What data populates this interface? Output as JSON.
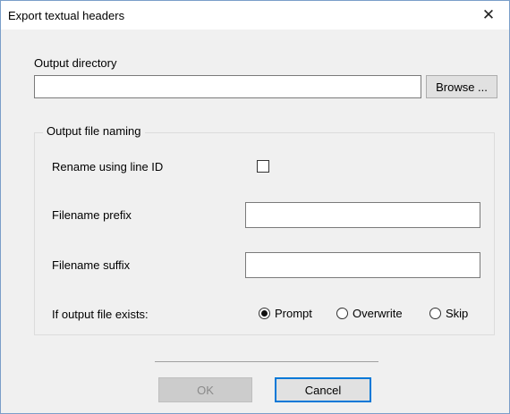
{
  "window": {
    "title": "Export textual headers",
    "close_glyph": "✕"
  },
  "output": {
    "directory_label": "Output directory",
    "directory_value": "",
    "browse_label": "Browse ..."
  },
  "naming": {
    "group_label": "Output file naming",
    "rename_label": "Rename using line ID",
    "rename_checked": false,
    "prefix_label": "Filename prefix",
    "prefix_value": "",
    "suffix_label": "Filename suffix",
    "suffix_value": "",
    "exists_label": "If output file exists:",
    "exists_options": [
      {
        "label": "Prompt",
        "selected": true
      },
      {
        "label": "Overwrite",
        "selected": false
      },
      {
        "label": "Skip",
        "selected": false
      }
    ]
  },
  "footer": {
    "ok_label": "OK",
    "cancel_label": "Cancel"
  },
  "colors": {
    "accent": "#0078d7",
    "window_border": "#7a9ec9"
  }
}
